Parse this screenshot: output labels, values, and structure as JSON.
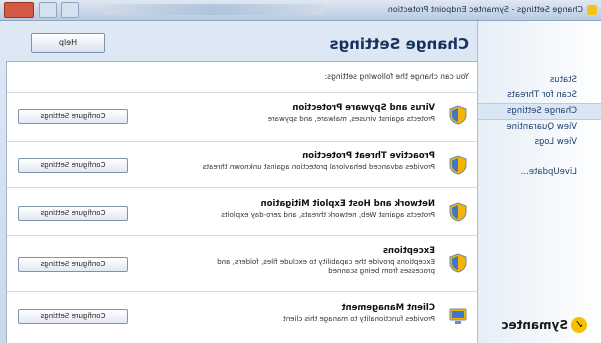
{
  "window": {
    "title": "Change Settings - Symantec Endpoint Protection"
  },
  "nav": {
    "items": [
      {
        "label": "Status"
      },
      {
        "label": "Scan for Threats"
      },
      {
        "label": "Change Settings",
        "selected": true
      },
      {
        "label": "View Quarantine"
      },
      {
        "label": "View Logs"
      }
    ],
    "secondary": [
      {
        "label": "LiveUpdate..."
      }
    ]
  },
  "brand": {
    "name": "Symantec",
    "icon": "check-icon",
    "color": "#f2c100"
  },
  "header": {
    "title": "Change Settings",
    "help_label": "Help"
  },
  "main": {
    "intro": "You can change the following settings:",
    "configure_label": "Configure Settings",
    "sections": [
      {
        "title": "Virus and Spyware Protection",
        "desc": "Protects against viruses, malware, and spyware"
      },
      {
        "title": "Proactive Threat Protection",
        "desc": "Provides advanced behavioral protection against unknown threats"
      },
      {
        "title": "Network and Host Exploit Mitigation",
        "desc": "Protects against Web, network threats, and zero-day exploits"
      },
      {
        "title": "Exceptions",
        "desc": "Exceptions provide the capability to exclude files, folders, and processes from being scanned"
      },
      {
        "title": "Client Management",
        "desc": "Provides functionality to manage this client"
      }
    ]
  },
  "colors": {
    "accent": "#15325f",
    "shield": "#f5b400"
  }
}
